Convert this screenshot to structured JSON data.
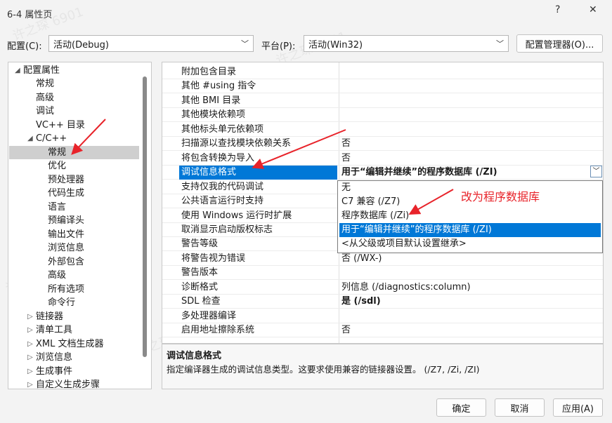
{
  "window": {
    "title": "6-4 属性页",
    "help": "?",
    "close": "✕"
  },
  "config": {
    "label": "配置(C):",
    "value": "活动(Debug)",
    "platform_label": "平台(P):",
    "platform_value": "活动(Win32)",
    "manager_button": "配置管理器(O)..."
  },
  "tree": {
    "items": [
      {
        "label": "配置属性",
        "expander": "◢"
      },
      {
        "label": "常规"
      },
      {
        "label": "高级"
      },
      {
        "label": "调试"
      },
      {
        "label": "VC++ 目录"
      },
      {
        "label": "C/C++",
        "expander": "◢"
      },
      {
        "label": "常规"
      },
      {
        "label": "优化"
      },
      {
        "label": "预处理器"
      },
      {
        "label": "代码生成"
      },
      {
        "label": "语言"
      },
      {
        "label": "预编译头"
      },
      {
        "label": "输出文件"
      },
      {
        "label": "浏览信息"
      },
      {
        "label": "外部包含"
      },
      {
        "label": "高级"
      },
      {
        "label": "所有选项"
      },
      {
        "label": "命令行"
      },
      {
        "label": "链接器",
        "expander": "▷"
      },
      {
        "label": "清单工具",
        "expander": "▷"
      },
      {
        "label": "XML 文档生成器",
        "expander": "▷"
      },
      {
        "label": "浏览信息",
        "expander": "▷"
      },
      {
        "label": "生成事件",
        "expander": "▷"
      },
      {
        "label": "自定义生成步骤",
        "expander": "▷"
      }
    ]
  },
  "grid": {
    "rows": [
      {
        "key": "附加包含目录",
        "value": ""
      },
      {
        "key": "其他 #using 指令",
        "value": ""
      },
      {
        "key": "其他 BMI 目录",
        "value": ""
      },
      {
        "key": "其他模块依赖项",
        "value": ""
      },
      {
        "key": "其他标头单元依赖项",
        "value": ""
      },
      {
        "key": "扫描源以查找模块依赖关系",
        "value": "否"
      },
      {
        "key": "将包含转换为导入",
        "value": "否"
      },
      {
        "key": "调试信息格式",
        "value": "用于“编辑并继续”的程序数据库 (/ZI)"
      },
      {
        "key": "支持仅我的代码调试",
        "value": ""
      },
      {
        "key": "公共语言运行时支持",
        "value": ""
      },
      {
        "key": "使用 Windows 运行时扩展",
        "value": ""
      },
      {
        "key": "取消显示启动版权标志",
        "value": ""
      },
      {
        "key": "警告等级",
        "value": ""
      },
      {
        "key": "将警告视为错误",
        "value": "否 (/WX-)"
      },
      {
        "key": "警告版本",
        "value": ""
      },
      {
        "key": "诊断格式",
        "value": "列信息 (/diagnostics:column)"
      },
      {
        "key": "SDL 检查",
        "value": "是 (/sdl)"
      },
      {
        "key": "多处理器编译",
        "value": ""
      },
      {
        "key": "启用地址擦除系统",
        "value": "否"
      }
    ],
    "dropdown_options": [
      "无",
      "C7 兼容 (/Z7)",
      "程序数据库 (/Zi)",
      "用于“编辑并继续”的程序数据库 (/ZI)",
      "<从父级或项目默认设置继承>"
    ]
  },
  "description": {
    "title": "调试信息格式",
    "text": "指定编译器生成的调试信息类型。这要求使用兼容的链接器设置。 (/Z7, /Zi, /ZI)"
  },
  "annotation": {
    "text": "改为程序数据库"
  },
  "watermark": "许之琛 6901",
  "buttons": {
    "ok": "确定",
    "cancel": "取消",
    "apply": "应用(A)"
  },
  "colors": {
    "selection": "#0078d7",
    "annotation": "#e8232a"
  }
}
